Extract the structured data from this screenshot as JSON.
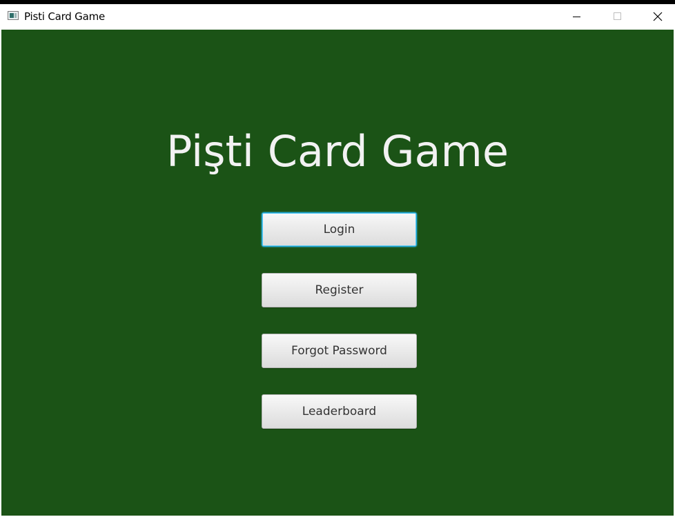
{
  "window": {
    "title": "Pisti Card Game",
    "icon": "app-window-icon",
    "controls": [
      "minimize-icon",
      "maximize-icon",
      "close-icon"
    ]
  },
  "main": {
    "heading": "Pişti Card Game",
    "buttons": {
      "login": "Login",
      "register": "Register",
      "forgot_password": "Forgot Password",
      "leaderboard": "Leaderboard"
    },
    "focused_button": "login"
  },
  "colors": {
    "background": "#1b5316",
    "heading_text": "#f2f2f2",
    "focus_ring": "#1aa5d6",
    "button_text": "#333333"
  }
}
